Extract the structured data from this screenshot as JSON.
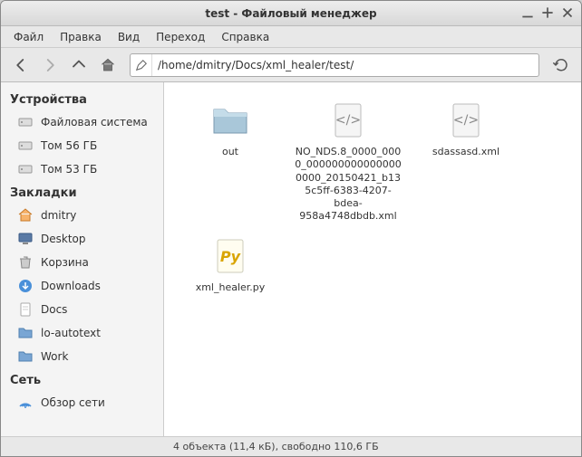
{
  "window": {
    "title": "test - Файловый менеджер"
  },
  "menubar": {
    "items": [
      "Файл",
      "Правка",
      "Вид",
      "Переход",
      "Справка"
    ]
  },
  "toolbar": {
    "path": "/home/dmitry/Docs/xml_healer/test/"
  },
  "sidebar": {
    "sections": [
      {
        "title": "Устройства",
        "items": [
          {
            "icon": "drive",
            "label": "Файловая система"
          },
          {
            "icon": "drive",
            "label": "Том 56 ГБ"
          },
          {
            "icon": "drive",
            "label": "Том 53 ГБ"
          }
        ]
      },
      {
        "title": "Закладки",
        "items": [
          {
            "icon": "home",
            "label": "dmitry"
          },
          {
            "icon": "desktop",
            "label": "Desktop"
          },
          {
            "icon": "trash",
            "label": "Корзина"
          },
          {
            "icon": "download",
            "label": "Downloads"
          },
          {
            "icon": "folder-doc",
            "label": "Docs"
          },
          {
            "icon": "folder",
            "label": "lo-autotext"
          },
          {
            "icon": "folder",
            "label": "Work"
          }
        ]
      },
      {
        "title": "Сеть",
        "items": [
          {
            "icon": "network",
            "label": "Обзор сети"
          }
        ]
      }
    ]
  },
  "content": {
    "items": [
      {
        "type": "folder",
        "name": "out"
      },
      {
        "type": "xml",
        "name": "NO_NDS.8_0000_0000_0000000000000000000_20150421_b135c5ff-6383-4207-bdea-958a4748dbdb.xml"
      },
      {
        "type": "xml",
        "name": "sdassasd.xml"
      },
      {
        "type": "python",
        "name": "xml_healer.py"
      }
    ]
  },
  "statusbar": {
    "text": "4 объекта (11,4 кБ), свободно 110,6 ГБ"
  }
}
